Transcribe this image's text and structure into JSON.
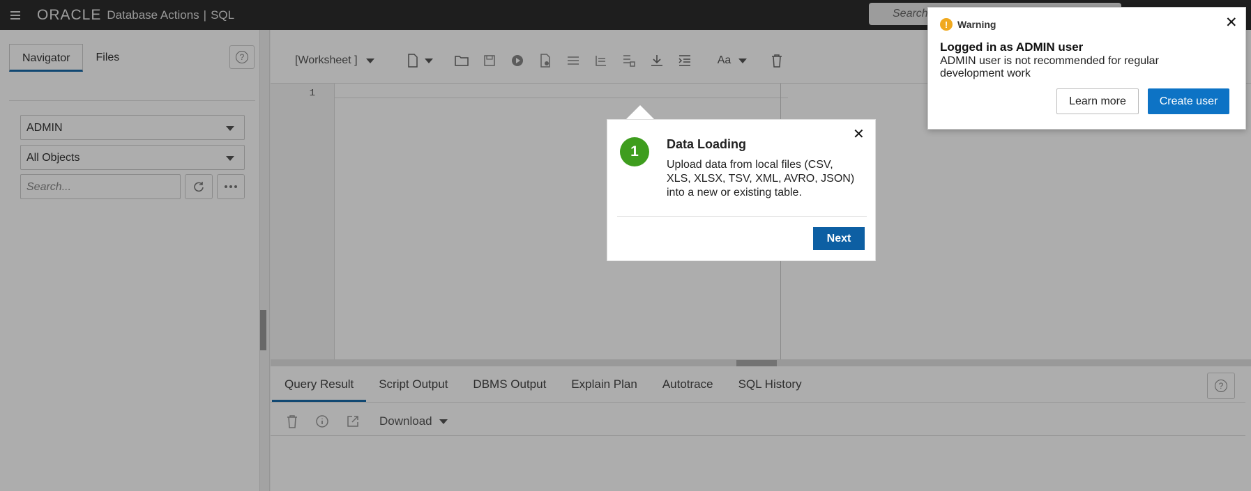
{
  "header": {
    "logo": "ORACLE",
    "app_title": "Database Actions",
    "separator": "|",
    "module": "SQL",
    "search_placeholder": "Search"
  },
  "navigator": {
    "tabs": [
      "Navigator",
      "Files"
    ],
    "active_tab": "Navigator",
    "schema_select": "ADMIN",
    "object_type_select": "All Objects",
    "search_placeholder": "Search..."
  },
  "worksheet": {
    "name": "[Worksheet ]",
    "line_numbers": [
      "1"
    ]
  },
  "results": {
    "tabs": [
      "Query Result",
      "Script Output",
      "DBMS Output",
      "Explain Plan",
      "Autotrace",
      "SQL History"
    ],
    "active_tab": "Query Result",
    "download_label": "Download"
  },
  "tour": {
    "step": "1",
    "title": "Data Loading",
    "body": "Upload data from local files (CSV, XLS, XLSX, TSV, XML, AVRO, JSON) into a new or existing table.",
    "next_label": "Next"
  },
  "warning": {
    "label": "Warning",
    "heading": "Logged in as ADMIN user",
    "body": "ADMIN user is not recommended for regular development work",
    "learn_more_label": "Learn more",
    "create_user_label": "Create user"
  },
  "colors": {
    "accent": "#1a6aa8",
    "step_badge": "#3e9d1e",
    "warning_icon": "#f0a91f",
    "primary_button": "#0d73c5"
  }
}
